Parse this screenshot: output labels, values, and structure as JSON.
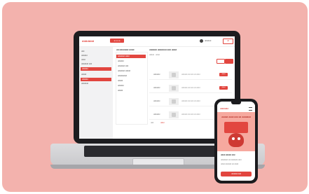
{
  "colors": {
    "background": "#f3b2ad",
    "accent": "#e2463f",
    "device": "#1c1c1f",
    "laptop_base": "#d3d3d6"
  },
  "laptop": {
    "app": {
      "logo": "ddddddd",
      "top_button": "● ● ● ●",
      "user": "dddddd",
      "login_button": "dd",
      "sidebar_items": [
        "ddd",
        "dddddd",
        "dddd",
        "ddddddd ddd",
        "dddddd",
        "ddddd",
        "dddddd",
        "ddddddd"
      ],
      "panel_header": "dd ddddddd dddd",
      "panel_items": [
        "ddddddd dddd",
        "dddddd",
        "ddddddd ddd",
        "ddddddd ddddd",
        "ddddddddd",
        "ddddd",
        "dddddd",
        "ddddd"
      ],
      "content_title": "dddddd ddddddd ddd dddd",
      "content_sub": "ddddd · dddd",
      "rows": [
        {
          "label": "ddddddd",
          "desc": "dddddd ddd ddd dd dddd",
          "action": "dddd"
        },
        {
          "label": "ddddddd",
          "desc": "dddddd ddd ddd dd dddd",
          "action": "dddd"
        },
        {
          "label": "ddddddd",
          "desc": "dddddd ddd ddd dd dddd",
          "action": "dddd"
        },
        {
          "label": "ddddddd",
          "desc": "dddddd ddd ddd dd dddd",
          "action": "dddd"
        }
      ],
      "footer_left": "ddd",
      "footer_right": "dddd"
    }
  },
  "phone": {
    "logo": "ddddddd",
    "banner_title": "ddddd dddd ddd dd ddddddd",
    "text_1": "dddd ddddd ddd",
    "text_2": "ddddddd dd ddddddd ddd",
    "text_3": "dddd dddddd dd dddd",
    "button": "dddddd ddd"
  }
}
